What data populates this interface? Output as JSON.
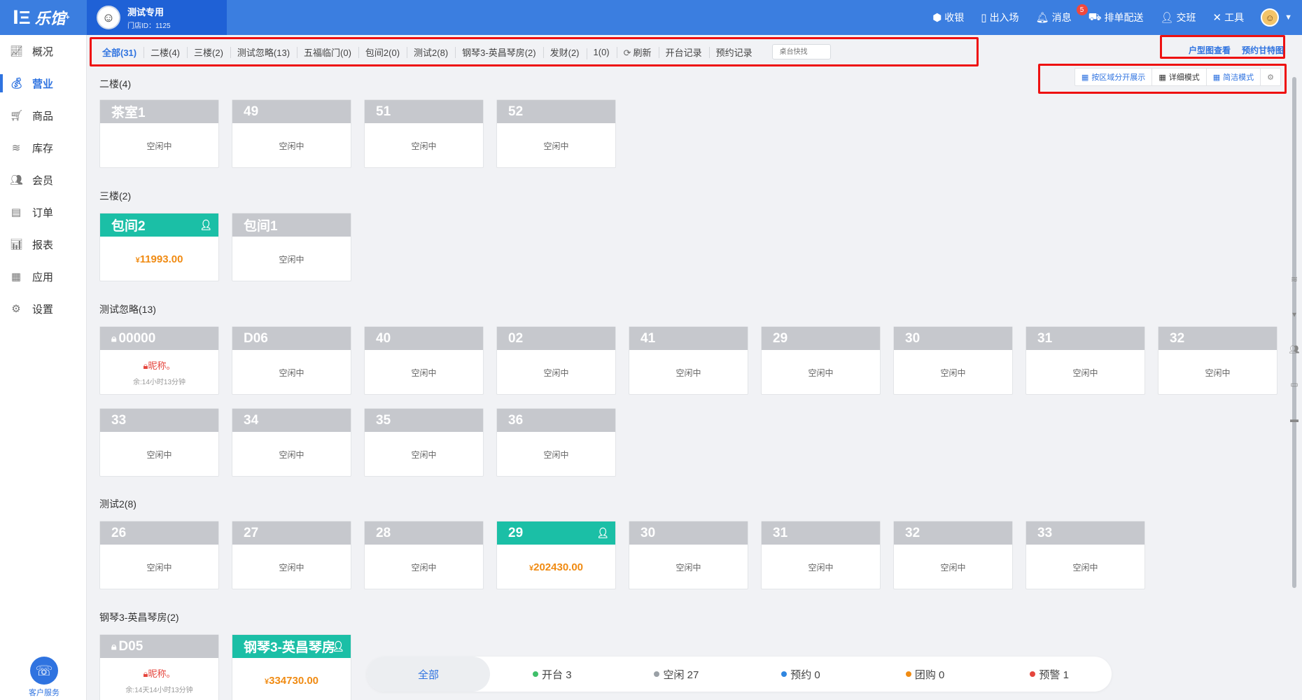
{
  "app": {
    "logo_mark": "ⅼΞ",
    "logo_text": "乐馆",
    "logo_sup": "+",
    "store_name": "测试专用",
    "store_id": "门店ID：1125"
  },
  "topnav": {
    "cashier": "收银",
    "in_out": "出入场",
    "messages": "消息",
    "messages_badge": "5",
    "dispatch": "排单配送",
    "handover": "交班",
    "tools": "工具"
  },
  "sidebar": {
    "items": [
      {
        "label": "概况",
        "icon": "chart-line-icon"
      },
      {
        "label": "营业",
        "icon": "money-bag-icon"
      },
      {
        "label": "商品",
        "icon": "cart-icon"
      },
      {
        "label": "库存",
        "icon": "layers-icon"
      },
      {
        "label": "会员",
        "icon": "users-icon"
      },
      {
        "label": "订单",
        "icon": "list-icon"
      },
      {
        "label": "报表",
        "icon": "bar-chart-icon"
      },
      {
        "label": "应用",
        "icon": "apps-icon"
      },
      {
        "label": "设置",
        "icon": "gear-icon"
      }
    ],
    "support": "客户服务"
  },
  "filters": {
    "tabs": [
      "全部(31)",
      "二楼(4)",
      "三楼(2)",
      "测试忽略(13)",
      "五福临门(0)",
      "包间2(0)",
      "测试2(8)",
      "钢琴3-英昌琴房(2)",
      "发财(2)",
      "1(0)"
    ],
    "refresh": "刷新",
    "open_records": "开台记录",
    "booking_records": "预约记录",
    "search_placeholder": "桌台快找",
    "floorplan_link": "户型图查看",
    "gantt_link": "预约甘特图"
  },
  "viewmodes": {
    "by_area": "按区域分开展示",
    "detail": "详细模式",
    "simple": "简洁模式"
  },
  "sections": {
    "s1": {
      "title": "二楼(4)",
      "cards": [
        {
          "name": "茶室1",
          "status": "空闲中"
        },
        {
          "name": "49",
          "status": "空闲中"
        },
        {
          "name": "51",
          "status": "空闲中"
        },
        {
          "name": "52",
          "status": "空闲中"
        }
      ]
    },
    "s2": {
      "title": "三楼(2)",
      "cards": [
        {
          "name": "包间2",
          "amount": "11993.00"
        },
        {
          "name": "包间1",
          "status": "空闲中"
        }
      ]
    },
    "s3": {
      "title": "测试忽略(13)",
      "cards": [
        {
          "name": "00000",
          "nick": "昵称。",
          "remain": "余:14小时13分钟"
        },
        {
          "name": "D06",
          "status": "空闲中"
        },
        {
          "name": "40",
          "status": "空闲中"
        },
        {
          "name": "02",
          "status": "空闲中"
        },
        {
          "name": "41",
          "status": "空闲中"
        },
        {
          "name": "29",
          "status": "空闲中"
        },
        {
          "name": "30",
          "status": "空闲中"
        },
        {
          "name": "31",
          "status": "空闲中"
        },
        {
          "name": "32",
          "status": "空闲中"
        },
        {
          "name": "33",
          "status": "空闲中"
        },
        {
          "name": "34",
          "status": "空闲中"
        },
        {
          "name": "35",
          "status": "空闲中"
        },
        {
          "name": "36",
          "status": "空闲中"
        }
      ]
    },
    "s4": {
      "title": "测试2(8)",
      "cards": [
        {
          "name": "26",
          "status": "空闲中"
        },
        {
          "name": "27",
          "status": "空闲中"
        },
        {
          "name": "28",
          "status": "空闲中"
        },
        {
          "name": "29",
          "amount": "202430.00"
        },
        {
          "name": "30",
          "status": "空闲中"
        },
        {
          "name": "31",
          "status": "空闲中"
        },
        {
          "name": "32",
          "status": "空闲中"
        },
        {
          "name": "33",
          "status": "空闲中"
        }
      ]
    },
    "s5": {
      "title": "钢琴3-英昌琴房(2)",
      "cards": [
        {
          "name": "D05",
          "nick": "昵称。",
          "remain": "余:14天14小时13分钟"
        },
        {
          "name": "钢琴3-英昌琴房",
          "amount": "334730.00"
        }
      ]
    }
  },
  "currency": "¥",
  "statusbar": {
    "all": "全部",
    "open": "开台 3",
    "idle": "空闲 27",
    "booked": "预约 0",
    "group": "团购 0",
    "alert": "预警 1"
  },
  "colors": {
    "primary": "#2f73e0",
    "busy": "#1bbfa6",
    "idle_header": "#c6c8cd",
    "amount": "#f08b13",
    "alert": "#e5453d",
    "dot_open": "#3fbf6a",
    "dot_idle": "#9aa0a6",
    "dot_booked": "#2f86e0",
    "dot_group": "#f08b13",
    "dot_alert": "#e5453d"
  }
}
